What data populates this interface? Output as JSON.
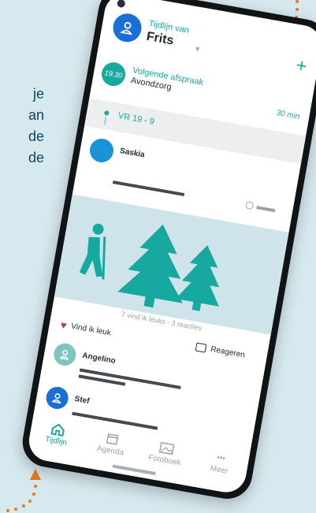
{
  "side_text": [
    "je",
    "an",
    "de",
    "de"
  ],
  "header": {
    "subtitle": "Tijdlijn van",
    "name": "Frits",
    "add_label": "+"
  },
  "appointment": {
    "time": "19.30",
    "title": "Volgende afspraak",
    "subtitle": "Avondzorg",
    "duration": "30 min"
  },
  "date_label": "VR 19 - 9",
  "post": {
    "author": "Saskia"
  },
  "stats": "7 vind ik leuks - 3 reacties",
  "actions": {
    "like_label": "Vind ik leuk",
    "react_label": "Reageren"
  },
  "comments": [
    {
      "author": "Angelino",
      "avatar_color": "#7ec6bd"
    },
    {
      "author": "Stef",
      "avatar_color": "#1a6fd6"
    }
  ],
  "tabs": [
    {
      "label": "Tijdlijn",
      "icon": "home-icon",
      "active": true
    },
    {
      "label": "Agenda",
      "icon": "calendar-icon",
      "active": false
    },
    {
      "label": "Fotoboek",
      "icon": "photo-icon",
      "active": false
    },
    {
      "label": "Meer",
      "icon": "more-icon",
      "active": false
    }
  ],
  "colors": {
    "accent": "#17a8a0",
    "background": "#d6e9ee",
    "phone": "#101416",
    "photo_bg": "#cfe4ea"
  }
}
